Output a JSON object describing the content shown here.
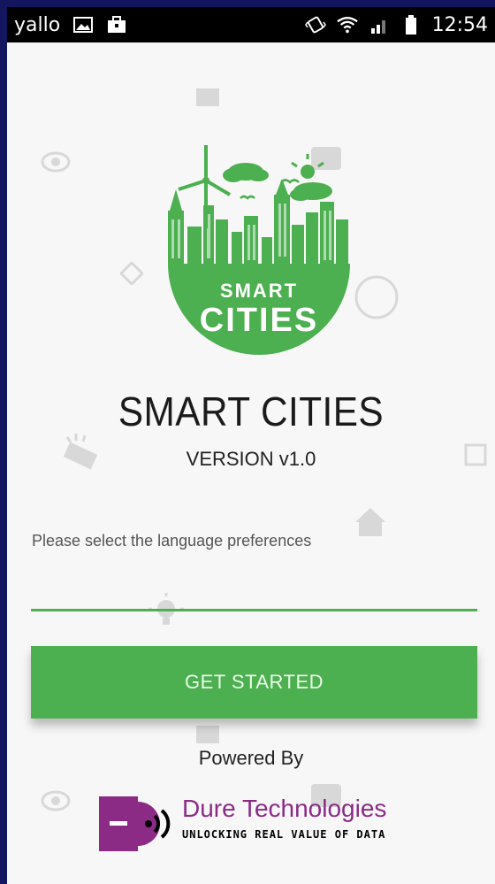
{
  "status_bar": {
    "carrier": "yallo",
    "time": "12:54",
    "icons": [
      "image-icon",
      "bag-icon",
      "vibrate-icon",
      "wifi-icon",
      "signal-icon",
      "battery-icon"
    ]
  },
  "app": {
    "logo_text_line1": "SMART",
    "logo_text_line2": "CITIES",
    "title": "SMART CITIES",
    "version": "VERSION v1.0",
    "language_prompt": "Please select the language preferences",
    "language_value": "",
    "get_started_label": "GET STARTED",
    "powered_by": "Powered By"
  },
  "footer_brand": {
    "name": "Dure Technologies",
    "tagline": "UNLOCKING REAL VALUE OF DATA"
  },
  "colors": {
    "accent": "#4caf50",
    "brand_purple": "#8b2b86",
    "frame": "#13155e"
  }
}
